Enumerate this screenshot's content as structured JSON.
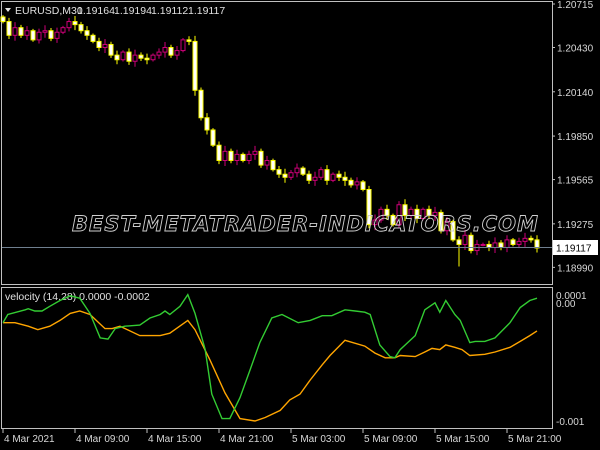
{
  "header": {
    "symbol": "EURUSD,M30",
    "open": "1.19164",
    "high": "1.19194",
    "low": "1.19112",
    "close": "1.19117"
  },
  "watermark": "BEST-METATRADER-INDICATORS.COM",
  "price_axis": {
    "labels": [
      "1.20715",
      "1.20430",
      "1.20140",
      "1.19850",
      "1.19565",
      "1.19275",
      "1.18990"
    ],
    "values": [
      1.20715,
      1.2043,
      1.2014,
      1.1985,
      1.19565,
      1.19275,
      1.1899
    ],
    "current_price": "1.19117"
  },
  "indicator": {
    "title": "velocity (14,28) 0.0000 -0.0002",
    "axis_labels": [
      "0.0001",
      "0.00",
      "-0.001"
    ],
    "colors": {
      "fast": "#33cc33",
      "slow": "#ffa500"
    }
  },
  "time_axis": {
    "labels": [
      "4 Mar 2021",
      "4 Mar 09:00",
      "4 Mar 15:00",
      "4 Mar 21:00",
      "5 Mar 03:00",
      "5 Mar 09:00",
      "5 Mar 15:00",
      "5 Mar 21:00"
    ],
    "bars": [
      0,
      12,
      24,
      36,
      48,
      60,
      72,
      84
    ]
  },
  "colors": {
    "bull": "#cc0077",
    "bear": "#ffff00",
    "bear_fill": "#ffffff",
    "grid": "#c0c0c0"
  },
  "chart_data": [
    {
      "type": "candlestick",
      "title": "EURUSD,M30",
      "ylim": [
        1.1885,
        1.2075
      ],
      "closes": [
        1.206,
        1.2051,
        1.2056,
        1.2051,
        1.2054,
        1.2048,
        1.2053,
        1.2054,
        1.2049,
        1.2053,
        1.2056,
        1.206,
        1.2058,
        1.2054,
        1.2051,
        1.2047,
        1.2043,
        1.2045,
        1.2038,
        1.2035,
        1.204,
        1.2034,
        1.2038,
        1.2036,
        1.2035,
        1.2038,
        1.204,
        1.2043,
        1.2038,
        1.2041,
        1.2048,
        1.2047,
        1.2015,
        1.1997,
        1.1989,
        1.1979,
        1.1969,
        1.1975,
        1.1969,
        1.1973,
        1.1969,
        1.1973,
        1.1975,
        1.1966,
        1.1969,
        1.1963,
        1.196,
        1.1958,
        1.1961,
        1.1964,
        1.196,
        1.1956,
        1.1958,
        1.1963,
        1.1956,
        1.196,
        1.1958,
        1.1956,
        1.1953,
        1.1955,
        1.195,
        1.1927,
        1.193,
        1.1937,
        1.1933,
        1.1927,
        1.194,
        1.1933,
        1.1937,
        1.1931,
        1.1937,
        1.1933,
        1.1935,
        1.1923,
        1.1929,
        1.1917,
        1.1914,
        1.192,
        1.191,
        1.1914,
        1.1914,
        1.1912,
        1.1915,
        1.1912,
        1.1917,
        1.1914,
        1.1916,
        1.1918,
        1.1917,
        1.19117
      ]
    },
    {
      "type": "line",
      "title": "velocity (14,28)",
      "ylim": [
        -0.001,
        0.0001
      ],
      "series": [
        {
          "name": "fast",
          "x": [
            0,
            0.8,
            3.7,
            4.2,
            5.3,
            6.5,
            7.8,
            9.5,
            11.2,
            12.8,
            14.5,
            16.2,
            17.5,
            18.7,
            20.3,
            22.8,
            24.5,
            26.2,
            27,
            27.8,
            29.5,
            30.8,
            32,
            33.7,
            34.8,
            36.5,
            37.8,
            39.5,
            41.2,
            42.8,
            44.8,
            46.5,
            49.2,
            51.2,
            53.2,
            54.8,
            57,
            58.7,
            60.3,
            61.2,
            62.8,
            64.5,
            65.3,
            66.2,
            68.7,
            70.3,
            72,
            72.8,
            73.8,
            75.3,
            76.2,
            77.8,
            78.7,
            80.3,
            82,
            84.5,
            86.2,
            87.8,
            89
          ],
          "values": [
            -0.00016,
            -9e-05,
            -5e-05,
            -4e-05,
            -6e-05,
            -6e-05,
            -2e-05,
            3e-05,
            7e-05,
            5e-05,
            -8e-05,
            -0.00029,
            -0.0003,
            -0.00021,
            -0.00019,
            -0.00018,
            -0.00012,
            -9e-05,
            -6e-05,
            -9e-05,
            -2e-05,
            8e-05,
            -8e-05,
            -0.00039,
            -0.00077,
            -0.00098,
            -0.00098,
            -0.0008,
            -0.00056,
            -0.00033,
            -0.00012,
            -9e-05,
            -0.00016,
            -0.00014,
            -0.0001,
            -0.0001,
            -5e-05,
            -6e-05,
            -7e-05,
            -9e-05,
            -0.00035,
            -0.00045,
            -0.00046,
            -0.00039,
            -0.00027,
            -5e-05,
            1e-05,
            -7e-05,
            3e-05,
            -9e-05,
            -0.00014,
            -0.00033,
            -0.00032,
            -0.00032,
            -0.00029,
            -0.00016,
            -3e-05,
            3e-05,
            5e-05
          ]
        },
        {
          "name": "slow",
          "x": [
            0,
            2,
            4.2,
            5.8,
            7.8,
            9.5,
            11.2,
            12.8,
            14.5,
            17,
            18.2,
            19.5,
            22.8,
            26.2,
            27.8,
            30.8,
            32,
            34.5,
            37,
            39.5,
            42,
            43.7,
            46.2,
            47.8,
            49.5,
            51.2,
            53.2,
            54.5,
            57,
            60.3,
            62,
            63.7,
            65.3,
            66.2,
            68.7,
            70.3,
            71.5,
            72.8,
            73.8,
            75.3,
            76.5,
            77.8,
            80.3,
            82,
            84.5,
            86.2,
            87.8,
            89
          ],
          "values": [
            -0.00016,
            -0.00016,
            -0.00019,
            -0.00022,
            -0.00019,
            -0.00014,
            -8e-05,
            -6e-05,
            -9e-05,
            -0.00021,
            -0.00021,
            -0.00019,
            -0.00027,
            -0.00027,
            -0.00025,
            -0.00014,
            -0.00022,
            -0.00048,
            -0.00076,
            -0.00098,
            -0.001,
            -0.00097,
            -0.00091,
            -0.00082,
            -0.00077,
            -0.00065,
            -0.00052,
            -0.00044,
            -0.00031,
            -0.00036,
            -0.00042,
            -0.00046,
            -0.00046,
            -0.00044,
            -0.00045,
            -0.00041,
            -0.00038,
            -0.00039,
            -0.00035,
            -0.00037,
            -0.00039,
            -0.00044,
            -0.00043,
            -0.00041,
            -0.00037,
            -0.00032,
            -0.00027,
            -0.00023
          ]
        }
      ]
    }
  ]
}
